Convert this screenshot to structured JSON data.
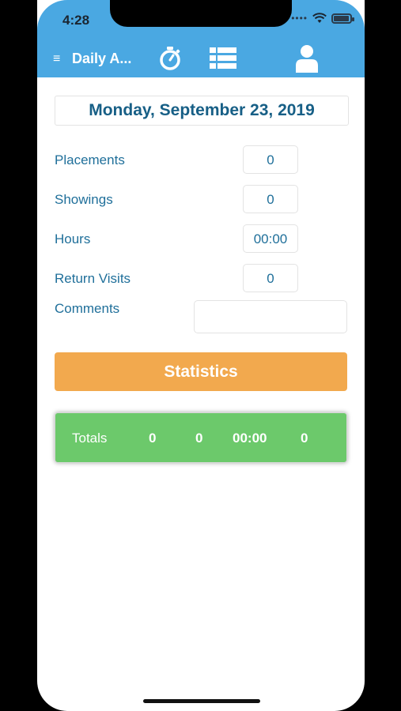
{
  "status_bar": {
    "time": "4:28"
  },
  "header": {
    "menu_glyph": "≡",
    "title": "Daily A..."
  },
  "date": "Monday, September 23, 2019",
  "fields": [
    {
      "label": "Placements",
      "value": "0"
    },
    {
      "label": "Showings",
      "value": "0"
    },
    {
      "label": "Hours",
      "value": "00:00"
    },
    {
      "label": "Return Visits",
      "value": "0"
    }
  ],
  "comments": {
    "label": "Comments",
    "value": ""
  },
  "statistics_button": "Statistics",
  "totals": {
    "label": "Totals",
    "values": [
      "0",
      "0",
      "00:00",
      "0"
    ]
  },
  "icons": [
    "menu-icon",
    "stopwatch-icon",
    "list-icon",
    "user-icon",
    "wifi-icon",
    "battery-icon"
  ],
  "colors": {
    "header": "#4aa8e2",
    "accent_text": "#1f6f9a",
    "stats_button": "#f2a94e",
    "totals_bar": "#6cc96b"
  }
}
